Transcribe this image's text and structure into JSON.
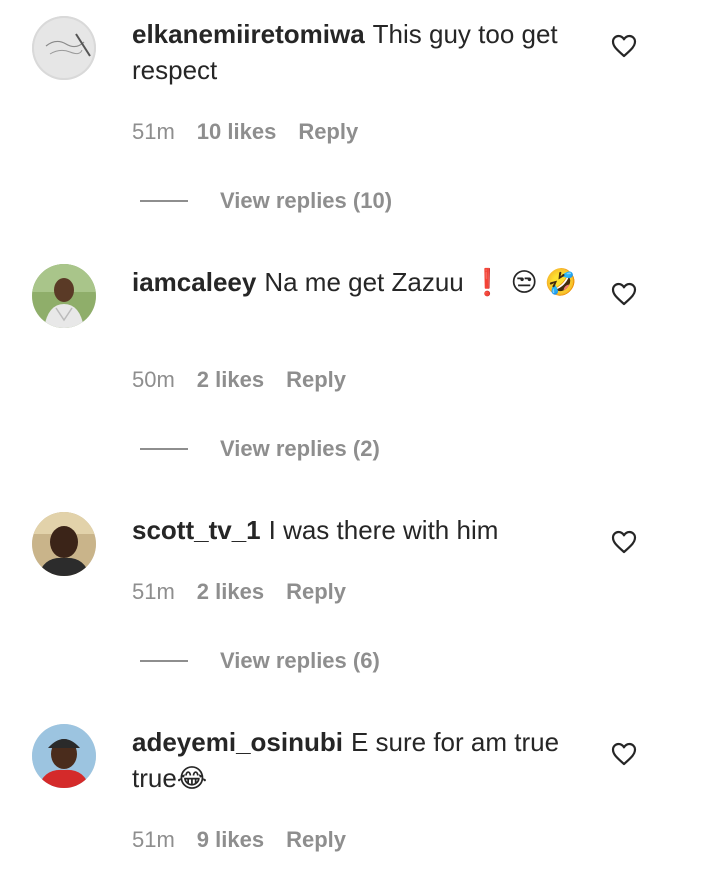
{
  "comments": [
    {
      "username": "elkanemiiretomiwa",
      "text": "This guy too get respect",
      "time": "51m",
      "likes": "10 likes",
      "reply": "Reply",
      "view_replies": "View replies (10)"
    },
    {
      "username": "iamcaleey",
      "text": "Na me get Zazuu ❗ 😒 🤣",
      "time": "50m",
      "likes": "2 likes",
      "reply": "Reply",
      "view_replies": "View replies (2)"
    },
    {
      "username": "scott_tv_1",
      "text": "I was there with him",
      "time": "51m",
      "likes": "2 likes",
      "reply": "Reply",
      "view_replies": "View replies (6)"
    },
    {
      "username": "adeyemi_osinubi",
      "text": "E sure for am true true😂",
      "time": "51m",
      "likes": "9 likes",
      "reply": "Reply"
    }
  ],
  "icons": {
    "like": "heart-outline-icon"
  },
  "colors": {
    "text": "#262626",
    "secondary": "#8e8e8e",
    "background": "#ffffff"
  }
}
